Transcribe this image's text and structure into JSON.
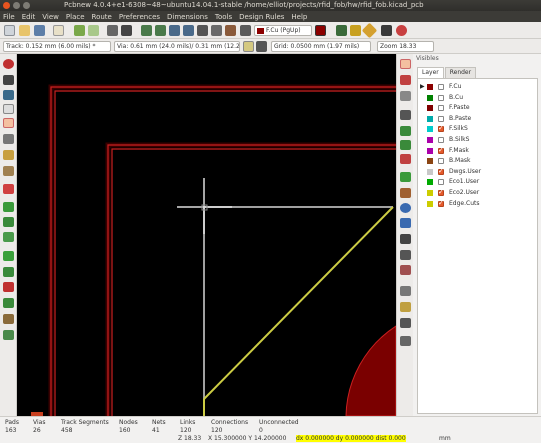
{
  "window": {
    "title": "Pcbnew 4.0.4+e1-6308~48~ubuntu14.04.1-stable /home/elliot/projects/rfid_fob/hw/rfid_fob.kicad_pcb"
  },
  "menu": [
    "File",
    "Edit",
    "View",
    "Place",
    "Route",
    "Preferences",
    "Dimensions",
    "Tools",
    "Design Rules",
    "Help"
  ],
  "toolbar2": {
    "track": "Track: 0.152 mm (6.00 mils) *",
    "via": "Via: 0.61 mm (24.0 mils)/ 0.31 mm (12.2 mils) *",
    "grid": "Grid: 0.0500 mm (1.97 mils)",
    "zoom": "Zoom 18.33"
  },
  "layer_select": {
    "label": "F.Cu (PgUp)",
    "color": "#8b0000"
  },
  "panel": {
    "header": "Visibles",
    "tabs": [
      "Layer",
      "Render"
    ],
    "layers": [
      {
        "name": "F.Cu",
        "color": "#8b0000",
        "checked": false,
        "active": true
      },
      {
        "name": "B.Cu",
        "color": "#008000",
        "checked": false
      },
      {
        "name": "F.Paste",
        "color": "#800000",
        "checked": false
      },
      {
        "name": "B.Paste",
        "color": "#00aaaa",
        "checked": false
      },
      {
        "name": "F.SilkS",
        "color": "#00cccc",
        "checked": true
      },
      {
        "name": "B.SilkS",
        "color": "#aa00aa",
        "checked": false
      },
      {
        "name": "F.Mask",
        "color": "#aa00aa",
        "checked": true
      },
      {
        "name": "B.Mask",
        "color": "#8b4513",
        "checked": false
      },
      {
        "name": "Dwgs.User",
        "color": "#c8c8c8",
        "checked": true
      },
      {
        "name": "Eco1.User",
        "color": "#00aa00",
        "checked": false
      },
      {
        "name": "Eco2.User",
        "color": "#cccc00",
        "checked": true
      },
      {
        "name": "Edge.Cuts",
        "color": "#cccc00",
        "checked": true
      }
    ]
  },
  "status": {
    "columns": [
      {
        "h": "Pads",
        "v": "163"
      },
      {
        "h": "Vias",
        "v": "26"
      },
      {
        "h": "Track Segments",
        "v": "458"
      },
      {
        "h": "Nodes",
        "v": "160"
      },
      {
        "h": "Nets",
        "v": "41"
      },
      {
        "h": "Links",
        "v": "120"
      },
      {
        "h": "Connections",
        "v": "120"
      },
      {
        "h": "Unconnected",
        "v": "0"
      }
    ],
    "zoom": "Z 18.33",
    "xy": "X 15.300000  Y 14.200000",
    "dxy": "dx 0.000000  dy 0.000000  dist 0.000",
    "units": "mm"
  },
  "colors": {
    "copper": "#8b0000",
    "copper_border": "#cc2020",
    "edge": "#cccc44",
    "cursor": "#c8c8c8"
  }
}
